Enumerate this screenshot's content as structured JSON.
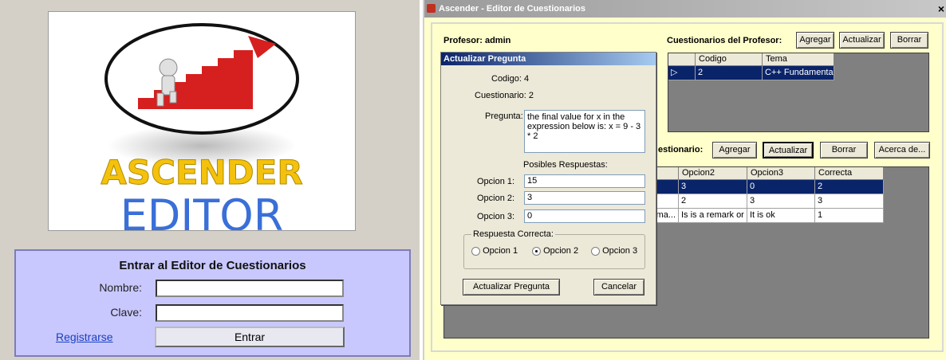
{
  "login": {
    "logo_line1": "ASCENDER",
    "logo_line2": "EDITOR",
    "title": "Entrar al Editor de Cuestionarios",
    "nombre_label": "Nombre:",
    "clave_label": "Clave:",
    "register_link": "Registrarse",
    "enter_button": "Entrar"
  },
  "editor": {
    "title": "Ascender - Editor de Cuestionarios",
    "close_glyph": "×",
    "profesor_label": "Profesor: admin",
    "cuestionarios_label": "Cuestionarios del Profesor:",
    "top_buttons": {
      "agregar": "Agregar",
      "actualizar": "Actualizar",
      "borrar": "Borrar"
    },
    "cuestionarios_grid": {
      "headers": [
        "Codigo",
        "Tema"
      ],
      "rows": [
        {
          "codigo": "2",
          "tema": "C++ Fundamentals"
        }
      ]
    },
    "preguntas_label": "estionario:",
    "mid_buttons": {
      "agregar": "Agregar",
      "actualizar": "Actualizar",
      "borrar": "Borrar",
      "acerca": "Acerca de..."
    },
    "preguntas_grid": {
      "headers": [
        "Opcion2",
        "Opcion3",
        "Correcta"
      ],
      "rows": [
        {
          "c0": "",
          "opcion2": "3",
          "opcion3": "0",
          "correcta": "2"
        },
        {
          "c0": "",
          "opcion2": "2",
          "opcion3": "3",
          "correcta": "3"
        },
        {
          "c0": "sma...",
          "opcion2": "Is is a remark or a...",
          "opcion3": "It is ok",
          "correcta": "1"
        }
      ]
    }
  },
  "dialog": {
    "title": "Actualizar Pregunta",
    "codigo": "Codigo: 4",
    "cuestionario": "Cuestionario: 2",
    "pregunta_label": "Pregunta:",
    "pregunta_value": "the final value for x in the expression below is: x = 9 - 3 * 2",
    "posibles_label": "Posibles Respuestas:",
    "opcion1_label": "Opcion 1:",
    "opcion1_value": "15",
    "opcion2_label": "Opcion 2:",
    "opcion2_value": "3",
    "opcion3_label": "Opcion 3:",
    "opcion3_value": "0",
    "correcta_group": "Respuesta Correcta:",
    "radio1": "Opcion 1",
    "radio2": "Opcion 2",
    "radio3": "Opcion 3",
    "selected_radio": 2,
    "update_button": "Actualizar Pregunta",
    "cancel_button": "Cancelar"
  },
  "colors": {
    "selection": "#0a246a",
    "editor_bg": "#ffffcc",
    "login_box": "#c8c8ff",
    "logo_yellow": "#f4c20d",
    "logo_blue": "#3a6fd8"
  }
}
